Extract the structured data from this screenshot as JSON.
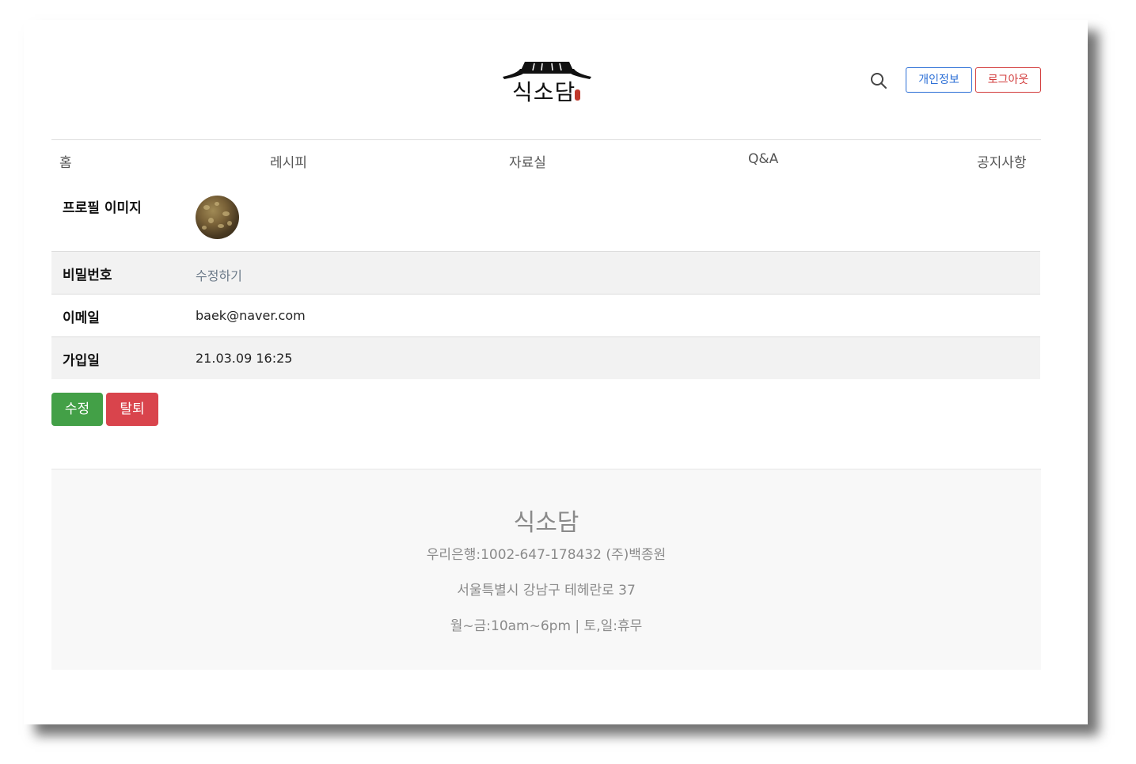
{
  "header": {
    "logo_text": "식소담",
    "search_icon": "search-icon",
    "privacy_label": "개인정보",
    "logout_label": "로그아웃",
    "colors": {
      "privacy": "#2c6fd6",
      "logout": "#d23b3b"
    }
  },
  "nav": {
    "items": [
      {
        "label": "홈"
      },
      {
        "label": "레시피"
      },
      {
        "label": "자료실"
      },
      {
        "label": "Q&A"
      },
      {
        "label": "공지사항"
      }
    ]
  },
  "profile": {
    "image_label": "프로필 이미지",
    "password_label": "비밀번호",
    "password_action": "수정하기",
    "email_label": "이메일",
    "email_value": "baek@naver.com",
    "joined_label": "가입일",
    "joined_value": "21.03.09 16:25"
  },
  "actions": {
    "edit_label": "수정",
    "withdraw_label": "탈퇴",
    "colors": {
      "edit": "#43a047",
      "withdraw": "#d9444c"
    }
  },
  "footer": {
    "title": "식소담",
    "bank": "우리은행:1002-647-178432 (주)백종원",
    "address": "서울특별시 강남구 테헤란로 37",
    "hours": "월~금:10am~6pm | 토,일:휴무"
  }
}
